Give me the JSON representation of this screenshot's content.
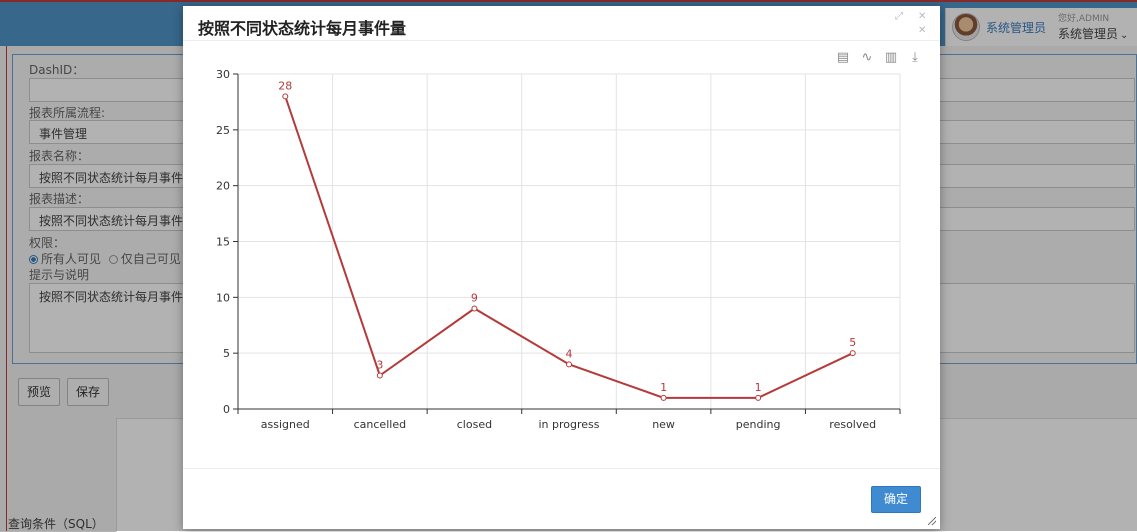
{
  "background": {
    "user": {
      "name": "系统管理员",
      "greeting": "您好,ADMIN",
      "role": "系统管理员"
    },
    "form": {
      "dash_label": "DashID：",
      "process_label": "报表所属流程:",
      "process_value": "事件管理",
      "name_label": "报表名称：",
      "name_value": "按照不同状态统计每月事件",
      "desc_label": "报表描述：",
      "desc_value": "按照不同状态统计每月事件",
      "perm_label": "权限：",
      "perm_options": [
        "所有人可见",
        "仅自己可见"
      ],
      "hint_label": "提示与说明",
      "hint_value": "按照不同状态统计每月事件"
    },
    "buttons": {
      "preview": "预览",
      "save": "保存"
    },
    "sql_label": "查询条件（SQL）"
  },
  "modal": {
    "title": "按照不同状态统计每月事件量",
    "maximize_glyph": "⤢",
    "close_glyph": "✕",
    "toolbox": [
      {
        "name": "data-view-icon",
        "glyph": "▤"
      },
      {
        "name": "line-chart-icon",
        "glyph": "∿"
      },
      {
        "name": "bar-chart-icon",
        "glyph": "▥"
      },
      {
        "name": "download-icon",
        "glyph": "⤓"
      }
    ],
    "ok_label": "确定"
  },
  "colors": {
    "line": "#b53a3a",
    "accent": "#3f8ad0",
    "topbar": "#4f94c7"
  },
  "chart_data": {
    "type": "line",
    "categories": [
      "assigned",
      "cancelled",
      "closed",
      "in progress",
      "new",
      "pending",
      "resolved"
    ],
    "values": [
      28,
      3,
      9,
      4,
      1,
      1,
      5
    ],
    "ylim": [
      0,
      30
    ],
    "yticks": [
      0,
      5,
      10,
      15,
      20,
      25,
      30
    ],
    "grid": true,
    "data_labels": true
  }
}
